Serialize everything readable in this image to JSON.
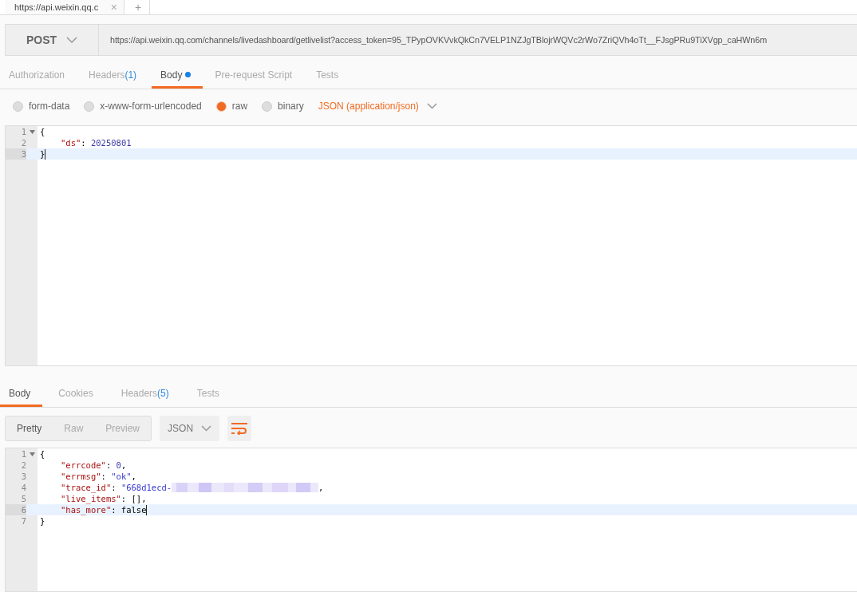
{
  "request_tab": {
    "title": "https://api.weixin.qq.c",
    "close": "×",
    "new_tab": "+"
  },
  "request": {
    "method": "POST",
    "url": "https://api.weixin.qq.com/channels/livedashboard/getlivelist?access_token=95_TPypOVKVvkQkCn7VELP1NZJgTBlojrWQVc2rWo7ZriQVh4oTt__FJsgPRu9TiXVgp_caHWn6m"
  },
  "request_tabs": [
    {
      "label": "Authorization",
      "selected": false
    },
    {
      "label": "Headers",
      "count": "(1)",
      "selected": false
    },
    {
      "label": "Body",
      "selected": true,
      "dot": true
    },
    {
      "label": "Pre-request Script",
      "selected": false
    },
    {
      "label": "Tests",
      "selected": false
    }
  ],
  "body_modes": [
    {
      "label": "form-data",
      "selected": false
    },
    {
      "label": "x-www-form-urlencoded",
      "selected": false
    },
    {
      "label": "raw",
      "selected": true
    },
    {
      "label": "binary",
      "selected": false
    }
  ],
  "content_type": "JSON (application/json)",
  "request_body": [
    {
      "number": "1",
      "fold": true,
      "indent": false,
      "active": false,
      "tokens": [
        {
          "kind": "punct",
          "text": "{"
        }
      ]
    },
    {
      "number": "2",
      "fold": false,
      "indent": true,
      "active": false,
      "tokens": [
        {
          "kind": "key",
          "text": "\"ds\""
        },
        {
          "kind": "punct",
          "text": ": "
        },
        {
          "kind": "number",
          "text": "20250801"
        }
      ]
    },
    {
      "number": "3",
      "fold": false,
      "indent": false,
      "active": true,
      "tokens": [
        {
          "kind": "punct",
          "text": "}"
        }
      ]
    }
  ],
  "response_tabs": [
    {
      "label": "Body",
      "selected": true
    },
    {
      "label": "Cookies",
      "selected": false
    },
    {
      "label": "Headers",
      "count": "(5)",
      "selected": false
    },
    {
      "label": "Tests",
      "selected": false
    }
  ],
  "view_modes": [
    {
      "label": "Pretty",
      "selected": true
    },
    {
      "label": "Raw",
      "selected": false
    },
    {
      "label": "Preview",
      "selected": false
    }
  ],
  "format": "JSON",
  "response_body": [
    {
      "number": "1",
      "fold": true,
      "indent": false,
      "active": false,
      "tokens": [
        {
          "kind": "punct",
          "text": "{"
        }
      ]
    },
    {
      "number": "2",
      "fold": false,
      "indent": true,
      "active": false,
      "tokens": [
        {
          "kind": "key",
          "text": "\"errcode\""
        },
        {
          "kind": "punct",
          "text": ": "
        },
        {
          "kind": "number",
          "text": "0"
        },
        {
          "kind": "punct",
          "text": ","
        }
      ]
    },
    {
      "number": "3",
      "fold": false,
      "indent": true,
      "active": false,
      "tokens": [
        {
          "kind": "key",
          "text": "\"errmsg\""
        },
        {
          "kind": "punct",
          "text": ": "
        },
        {
          "kind": "string",
          "text": "\"ok\""
        },
        {
          "kind": "punct",
          "text": ","
        }
      ]
    },
    {
      "number": "4",
      "fold": false,
      "indent": true,
      "active": false,
      "tokens": [
        {
          "kind": "key",
          "text": "\"trace_id\""
        },
        {
          "kind": "punct",
          "text": ": "
        },
        {
          "kind": "string",
          "text": "\"668d1ecd-"
        },
        {
          "kind": "redacted"
        },
        {
          "kind": "punct",
          "text": ","
        }
      ]
    },
    {
      "number": "5",
      "fold": false,
      "indent": true,
      "active": false,
      "tokens": [
        {
          "kind": "key",
          "text": "\"live_items\""
        },
        {
          "kind": "punct",
          "text": ": [],"
        }
      ]
    },
    {
      "number": "6",
      "fold": false,
      "indent": true,
      "active": true,
      "tokens": [
        {
          "kind": "key",
          "text": "\"has_more\""
        },
        {
          "kind": "punct",
          "text": ": false"
        }
      ]
    },
    {
      "number": "7",
      "fold": false,
      "indent": false,
      "active": false,
      "tokens": [
        {
          "kind": "punct",
          "text": "}"
        }
      ]
    }
  ]
}
